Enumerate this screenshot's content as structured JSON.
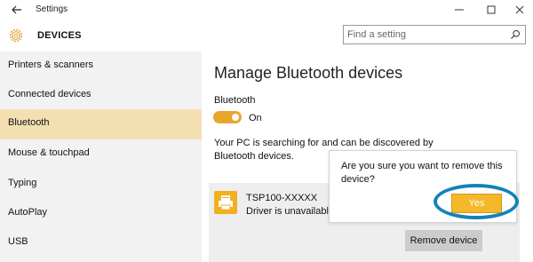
{
  "window": {
    "title": "Settings",
    "section": "DEVICES",
    "search_placeholder": "Find a setting",
    "icons": {
      "back": "back-arrow-icon",
      "minimize": "minimize-icon",
      "maximize": "maximize-icon",
      "close": "close-icon",
      "settings": "gear-icon",
      "search": "search-icon"
    }
  },
  "sidebar": {
    "items": [
      {
        "label": "Printers & scanners",
        "active": false
      },
      {
        "label": "Connected devices",
        "active": false
      },
      {
        "label": "Bluetooth",
        "active": true
      },
      {
        "label": "Mouse & touchpad",
        "active": false
      },
      {
        "label": "Typing",
        "active": false
      },
      {
        "label": "AutoPlay",
        "active": false
      },
      {
        "label": "USB",
        "active": false
      }
    ]
  },
  "main": {
    "title": "Manage Bluetooth devices",
    "bluetooth_label": "Bluetooth",
    "toggle_state": "On",
    "toggle_on": true,
    "description": "Your PC is searching for and can be discovered by Bluetooth devices.",
    "device": {
      "name": "TSP100-XXXXX",
      "status": "Driver is unavailable",
      "icon": "printer-icon",
      "remove_label": "Remove device"
    }
  },
  "dialog": {
    "message": "Are you sure you want to remove this device?",
    "confirm_label": "Yes"
  },
  "colors": {
    "accent": "#f4b828",
    "active_nav": "#f4dfb2",
    "highlight_ring": "#1282b8",
    "sidebar_bg": "#f2f2f2"
  }
}
